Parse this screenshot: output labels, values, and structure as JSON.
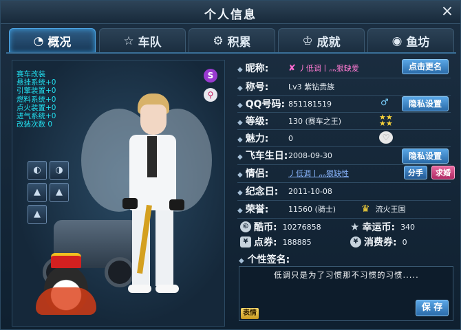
{
  "window": {
    "title": "个人信息",
    "close_icon": "×"
  },
  "tabs": [
    {
      "label": "概况",
      "icon": "◔",
      "active": true
    },
    {
      "label": "车队",
      "icon": "☆",
      "active": false
    },
    {
      "label": "积累",
      "icon": "⚙",
      "active": false
    },
    {
      "label": "成就",
      "icon": "♔",
      "active": false
    },
    {
      "label": "鱼坊",
      "icon": "◉",
      "active": false
    }
  ],
  "character": {
    "stats": [
      "赛车改装",
      "悬挂系统+0",
      "引擎装置+0",
      "燃料系统+0",
      "点火装置+0",
      "进气系统+0",
      "改装次数 0"
    ]
  },
  "profile": {
    "nickname_label": "昵称:",
    "nickname": "丿低调丨灬狠缺爱",
    "rename_button": "点击更名",
    "title_label": "称号:",
    "title_value": "Lv3 紫钻贵族",
    "qq_label": "QQ号码:",
    "qq_value": "851181519",
    "privacy_button": "隐私设置",
    "level_label": "等级:",
    "level_value": "130 (赛车之王)",
    "charm_label": "魅力:",
    "charm_value": "0",
    "birthday_label": "飞车生日:",
    "birthday_value": "2008-09-30",
    "privacy_button2": "隐私设置",
    "partner_label": "情侣:",
    "partner_value": "丿低调丨灬狠缺性",
    "breakup_button": "分手",
    "propose_button": "求婚",
    "anniversary_label": "纪念日:",
    "anniversary_value": "2011-10-08",
    "honor_label": "荣誉:",
    "honor_value": "11560 (骑士)",
    "kingdom_value": "流火王国"
  },
  "currency": {
    "cool_label": "酷币:",
    "cool_value": "10276858",
    "lucky_label": "幸运币:",
    "lucky_value": "340",
    "points_label": "点券:",
    "points_value": "188885",
    "consume_label": "消费券:",
    "consume_value": "0"
  },
  "signature": {
    "label": "个性签名:",
    "text": "低调只是为了习惯那不习惯的习惯.....",
    "emote_button": "表情",
    "save_button": "保 存"
  },
  "colors": {
    "accent": "#4fa8e8",
    "stats_text": "#22e0f0",
    "nickname": "#ff7ad2",
    "link": "#8ab6ff"
  }
}
